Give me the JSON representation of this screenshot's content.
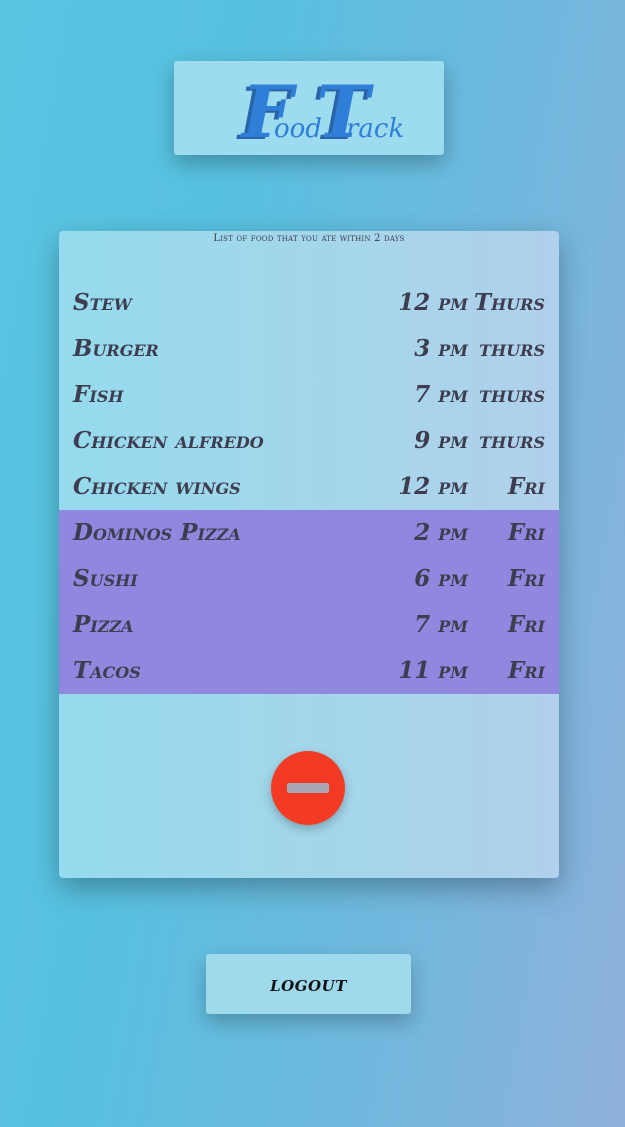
{
  "app": {
    "logo_big_f": "F",
    "logo_small_1": "ood",
    "logo_big_t": "T",
    "logo_small_2": "rack"
  },
  "panel": {
    "caption": "List of food that you ate within 2 days",
    "items": [
      {
        "name": "Stew",
        "time": "12 pm",
        "day": "Thurs",
        "highlighted": false
      },
      {
        "name": "Burger",
        "time": "3 pm",
        "day": "thurs",
        "highlighted": false
      },
      {
        "name": "Fish",
        "time": "7 pm",
        "day": "thurs",
        "highlighted": false
      },
      {
        "name": "Chicken alfredo",
        "time": "9 pm",
        "day": "thurs",
        "highlighted": false
      },
      {
        "name": "Chicken wings",
        "time": "12 pm",
        "day": "Fri",
        "highlighted": false
      },
      {
        "name": "Dominos Pizza",
        "time": "2 pm",
        "day": "Fri",
        "highlighted": true
      },
      {
        "name": "Sushi",
        "time": "6 pm",
        "day": "Fri",
        "highlighted": true
      },
      {
        "name": "Pizza",
        "time": "7 pm",
        "day": "Fri",
        "highlighted": true
      },
      {
        "name": "Tacos",
        "time": "11 pm",
        "day": "Fri",
        "highlighted": true
      }
    ],
    "remove_icon": "minus-icon"
  },
  "footer": {
    "logout_label": "logout"
  },
  "colors": {
    "highlight": "#9088df",
    "remove_button": "#f23a24",
    "logo_blue": "#2f7fd8"
  }
}
